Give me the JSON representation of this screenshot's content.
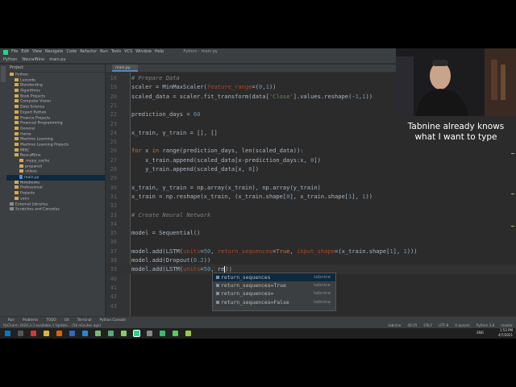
{
  "menubar": {
    "items": [
      "File",
      "Edit",
      "View",
      "Navigate",
      "Code",
      "Refactor",
      "Run",
      "Tools",
      "VCS",
      "Window",
      "Help"
    ],
    "title": "Python - main.py"
  },
  "navbar": {
    "crumbs": [
      "Python",
      "NeuralNine",
      "main.py"
    ]
  },
  "project_panel": {
    "header": "Project",
    "items": [
      {
        "label": "Python",
        "type": "folder",
        "depth": 0
      },
      {
        "label": "Lexcode",
        "type": "folder",
        "depth": 1
      },
      {
        "label": "Blenderding",
        "type": "folder",
        "depth": 1
      },
      {
        "label": "Algorithms",
        "type": "folder",
        "depth": 1
      },
      {
        "label": "Book Projects",
        "type": "folder",
        "depth": 1
      },
      {
        "label": "Computer Vision",
        "type": "folder",
        "depth": 1
      },
      {
        "label": "Data Science",
        "type": "folder",
        "depth": 1
      },
      {
        "label": "Expert Python",
        "type": "folder",
        "depth": 1
      },
      {
        "label": "Finance Projects",
        "type": "folder",
        "depth": 1
      },
      {
        "label": "Financial Programming",
        "type": "folder",
        "depth": 1
      },
      {
        "label": "General",
        "type": "folder",
        "depth": 1
      },
      {
        "label": "Home",
        "type": "folder",
        "depth": 1
      },
      {
        "label": "Machine Learning",
        "type": "folder",
        "depth": 1
      },
      {
        "label": "Machine Learning Projects",
        "type": "folder",
        "depth": 1
      },
      {
        "label": "MISC",
        "type": "folder",
        "depth": 1
      },
      {
        "label": "NeuralNine",
        "type": "folder",
        "depth": 1
      },
      {
        "label": ".mypy_cache",
        "type": "folder",
        "depth": 2
      },
      {
        "label": "prepared",
        "type": "folder",
        "depth": 2
      },
      {
        "label": "videos",
        "type": "folder",
        "depth": 2
      },
      {
        "label": "main.py",
        "type": "file",
        "depth": 2,
        "selected": true
      },
      {
        "label": "Notebooks",
        "type": "folder",
        "depth": 1
      },
      {
        "label": "Professional",
        "type": "folder",
        "depth": 1
      },
      {
        "label": "Projects",
        "type": "folder",
        "depth": 1
      },
      {
        "label": "venv",
        "type": "folder",
        "depth": 1
      },
      {
        "label": "External Libraries",
        "type": "grey",
        "depth": 0
      },
      {
        "label": "Scratches and Consoles",
        "type": "grey",
        "depth": 0
      }
    ]
  },
  "editor": {
    "tab_label": "main.py",
    "lines": [
      {
        "n": "18",
        "html": "<span class='cm'># Prepare Data</span>"
      },
      {
        "n": "19",
        "html": "scaler = MinMaxScaler(<span class='prm'>feature_range</span>=(<span class='num'>0</span>,<span class='num'>1</span>))"
      },
      {
        "n": "20",
        "html": "scaled_data = scaler.fit_transform(data[<span class='str'>'Close'</span>].values.reshape(-<span class='num'>1</span>,<span class='num'>1</span>))"
      },
      {
        "n": "21",
        "html": ""
      },
      {
        "n": "22",
        "html": "prediction_days = <span class='num'>60</span>"
      },
      {
        "n": "23",
        "html": ""
      },
      {
        "n": "24",
        "html": "x_train, y_train = [], []"
      },
      {
        "n": "25",
        "html": ""
      },
      {
        "n": "26",
        "html": "<span class='kw'>for</span> x <span class='kw'>in</span> range(prediction_days, len(scaled_data)):"
      },
      {
        "n": "27",
        "html": "    x_train.append(scaled_data[x-prediction_days:x, <span class='num'>0</span>])"
      },
      {
        "n": "28",
        "html": "    y_train.append(scaled_data[x, <span class='num'>0</span>])"
      },
      {
        "n": "29",
        "html": ""
      },
      {
        "n": "30",
        "html": "x_train, y_train = np.array(x_train), np.array(y_train)"
      },
      {
        "n": "31",
        "html": "x_train = np.reshape(x_train, (x_train.shape[<span class='num'>0</span>], x_train.shape[<span class='num'>1</span>], <span class='num'>1</span>))"
      },
      {
        "n": "32",
        "html": ""
      },
      {
        "n": "33",
        "html": "<span class='cm'># Create Neural Network</span>"
      },
      {
        "n": "34",
        "html": ""
      },
      {
        "n": "35",
        "html": "model = Sequential()"
      },
      {
        "n": "36",
        "html": ""
      },
      {
        "n": "37",
        "html": "model.add(LSTM(<span class='prm'>units</span>=<span class='num'>50</span>, <span class='prm'>return_sequences</span>=<span class='kw'>True</span>, <span class='prm'>input_shape</span>=(x_train.shape[<span class='num'>1</span>], <span class='num'>1</span>)))"
      },
      {
        "n": "38",
        "html": "model.add(Dropout(<span class='num'>0.2</span>))"
      },
      {
        "n": "39",
        "html": "model.add(LSTM(<span class='prm'>units</span>=<span class='num'>50</span>, re<span class='caret'></span>))"
      },
      {
        "n": "40",
        "html": ""
      },
      {
        "n": "41",
        "html": ""
      },
      {
        "n": "42",
        "html": ""
      },
      {
        "n": "43",
        "html": ""
      }
    ]
  },
  "completion": {
    "items": [
      {
        "text": "return_sequences",
        "source": "tabnine"
      },
      {
        "text": "return_sequences=True",
        "source": "tabnine"
      },
      {
        "text": "return_sequences=",
        "source": "tabnine"
      },
      {
        "text": "return_sequences=False",
        "source": "tabnine"
      }
    ]
  },
  "caption": {
    "line1": "Tabnine already knows",
    "line2": "what I want to type"
  },
  "bottom_tools": [
    "Run",
    "Problems",
    "TODO",
    "Git",
    "Terminal",
    "Python Console"
  ],
  "statusbar": {
    "left": "PyCharm 2020.3.3 available // Update... (56 minutes ago)",
    "right": [
      "tabnine",
      "40:25",
      "CRLF",
      "UTF-8",
      "4 spaces",
      "Python 3.8",
      "master"
    ]
  },
  "taskbar": {
    "time": "1:53 PM",
    "date": "4/7/2021",
    "lang": "ENG"
  },
  "colors": {
    "accent": "#4a88c7",
    "keyword": "#cc7832",
    "number": "#6897bb",
    "string": "#6a8759"
  }
}
